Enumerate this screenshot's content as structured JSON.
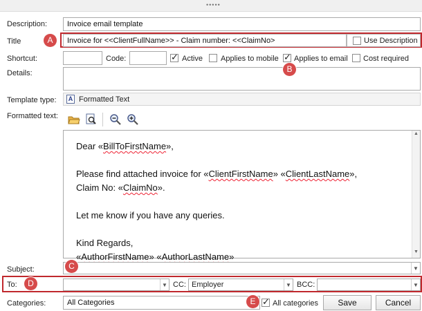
{
  "labels": {
    "description": "Description:",
    "title": "Title",
    "shortcut": "Shortcut:",
    "code": "Code:",
    "details": "Details:",
    "template_type": "Template type:",
    "formatted_text": "Formatted text:",
    "subject": "Subject:",
    "to": "To:",
    "cc": "CC:",
    "bcc": "BCC:",
    "categories": "Categories:"
  },
  "fields": {
    "description": "Invoice email template",
    "title": "Invoice for <<ClientFullName>> - Claim number: <<ClaimNo>",
    "shortcut": "",
    "code": "",
    "details": "",
    "subject": "",
    "to": "",
    "cc": "Employer",
    "bcc": "",
    "categories": "All Categories",
    "template_type": "Formatted Text"
  },
  "checkboxes": {
    "use_description": {
      "label": "Use Description",
      "checked": false
    },
    "active": {
      "label": "Active",
      "checked": true
    },
    "applies_mobile": {
      "label": "Applies to mobile",
      "checked": false
    },
    "applies_email": {
      "label": "Applies to email",
      "checked": true
    },
    "cost_required": {
      "label": "Cost required",
      "checked": false
    },
    "all_categories": {
      "label": "All categories",
      "checked": true
    }
  },
  "editor": {
    "greeting_prefix": "Dear «",
    "greeting_field": "BillToFirstName",
    "greeting_suffix": "»,",
    "line2_prefix": "Please find attached invoice for «",
    "line2_field1": "ClientFirstName",
    "line2_mid": "» «",
    "line2_field2": "ClientLastName",
    "line2_suffix": "»,",
    "line3_prefix": "Claim No: «",
    "line3_field": "ClaimNo",
    "line3_suffix": "».",
    "line4": "Let me know if you have any queries.",
    "line5": "Kind Regards,",
    "line6_prefix": "«",
    "line6_field1": "AuthorFirstName",
    "line6_mid": "» «",
    "line6_field2": "AuthorLastName",
    "line6_suffix": "»"
  },
  "markers": [
    "A",
    "B",
    "C",
    "D",
    "E"
  ],
  "buttons": {
    "save": "Save",
    "cancel": "Cancel"
  },
  "toolbar_icons": [
    "open-folder-icon",
    "preview-icon",
    "zoom-out-icon",
    "zoom-in-icon"
  ],
  "colors": {
    "annotation_red": "#c0282d",
    "marker_fill": "#d64b4b"
  }
}
